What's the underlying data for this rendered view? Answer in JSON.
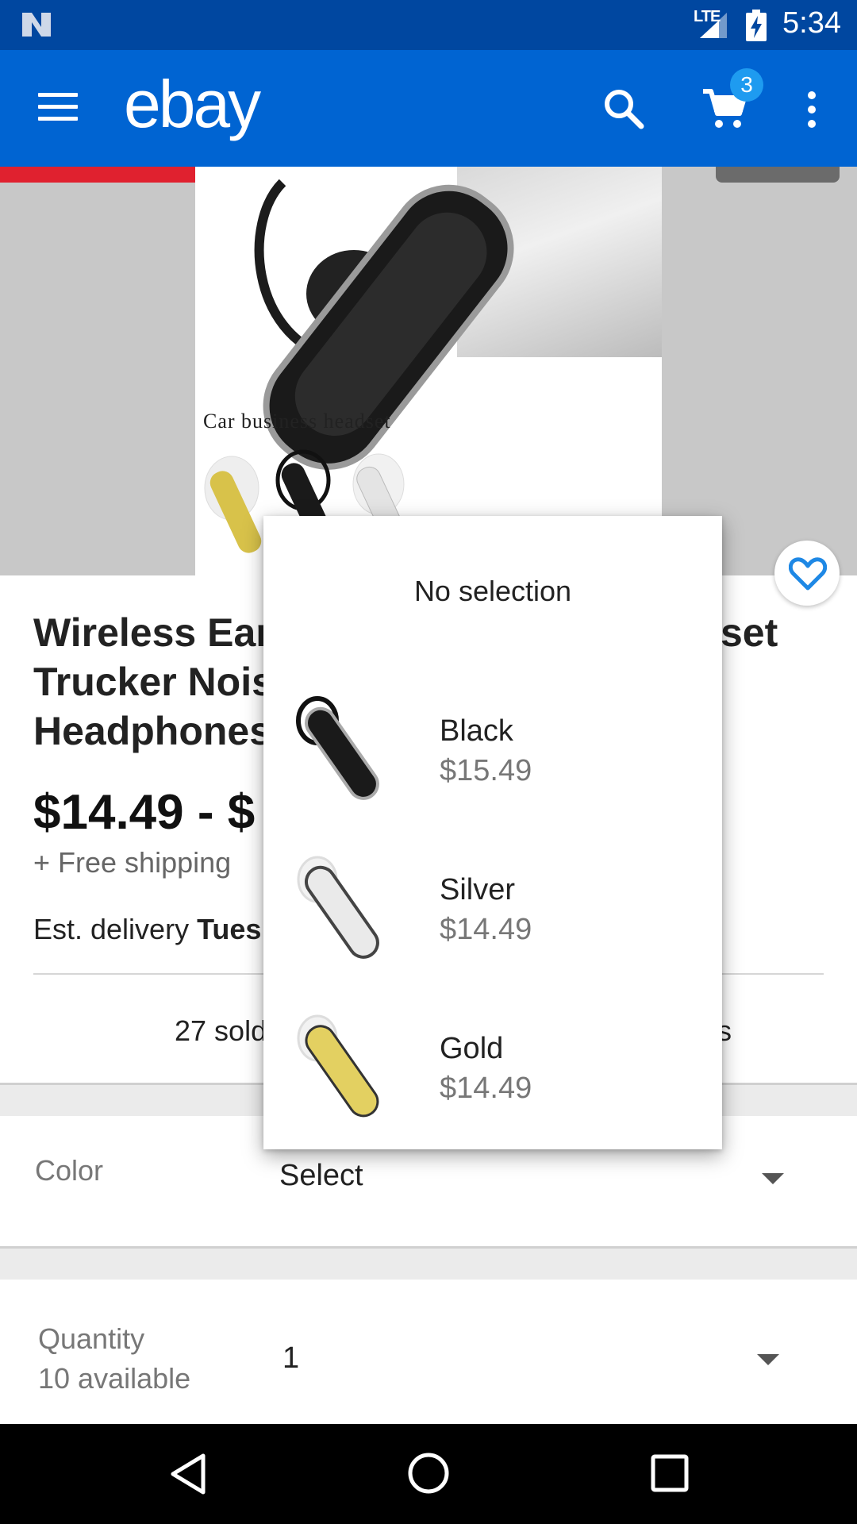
{
  "status_bar": {
    "network": "LTE",
    "time": "5:34"
  },
  "app_bar": {
    "brand": "ebay",
    "cart_count": "3"
  },
  "gallery": {
    "caption": "Car business headset"
  },
  "product": {
    "title_visible": "Wireless Ear… set Trucker Nois… Headphones…",
    "title_lines": [
      "Wireless Ear",
      "Trucker Nois",
      "Headphones"
    ],
    "title_tail": "set",
    "price": "$14.49 - $",
    "shipping": "+ Free shipping",
    "delivery_prefix": "Est. delivery ",
    "delivery_bold": "Tues",
    "sold": "27 sold",
    "watchers_tail": "s"
  },
  "color_row": {
    "label": "Color",
    "value": "Select"
  },
  "quantity_row": {
    "label": "Quantity",
    "sublabel": "10 available",
    "value": "1"
  },
  "dropdown": {
    "no_selection": "No selection",
    "options": [
      {
        "name": "Black",
        "price": "$15.49",
        "swatch": "#1a1a1a"
      },
      {
        "name": "Silver",
        "price": "$14.49",
        "swatch": "#e8e8e8"
      },
      {
        "name": "Gold",
        "price": "$14.49",
        "swatch": "#e7d56a"
      }
    ]
  },
  "colors": {
    "status_bar": "#0047a0",
    "app_bar": "#0064d2",
    "badge": "#1e9bf0",
    "heart": "#1e88e5"
  }
}
